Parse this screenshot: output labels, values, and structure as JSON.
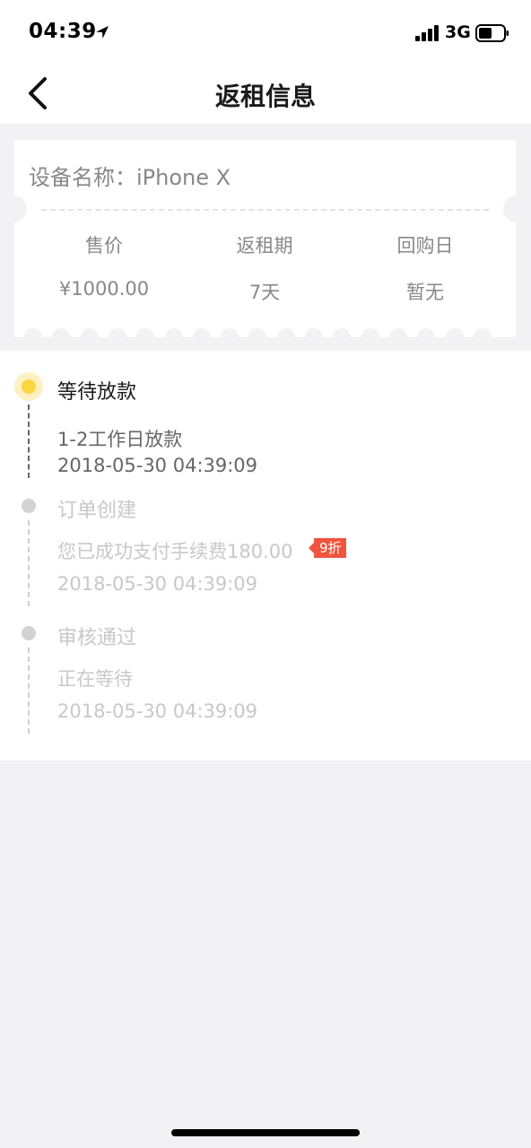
{
  "status_bar": {
    "time": "04:39",
    "network": "3G"
  },
  "nav": {
    "title": "返租信息",
    "back_icon": "chevron-left-icon"
  },
  "device": {
    "label": "设备名称：",
    "name": "iPhone X"
  },
  "info": {
    "price_label": "售价",
    "price_value": "¥1000.00",
    "period_label": "返租期",
    "period_value": "7天",
    "buyback_label": "回购日",
    "buyback_value": "暂无"
  },
  "timeline": [
    {
      "title": "等待放款",
      "desc": "1-2工作日放款",
      "time": "2018-05-30 04:39:09",
      "active": true
    },
    {
      "title": "订单创建",
      "desc": "您已成功支付手续费180.00",
      "badge": "9折",
      "time": "2018-05-30 04:39:09",
      "active": false
    },
    {
      "title": "审核通过",
      "desc": "正在等待",
      "time": "2018-05-30 04:39:09",
      "active": false
    }
  ],
  "colors": {
    "accent_yellow": "#fcd53f",
    "badge_red": "#f0553e",
    "background": "#f2f2f4"
  }
}
